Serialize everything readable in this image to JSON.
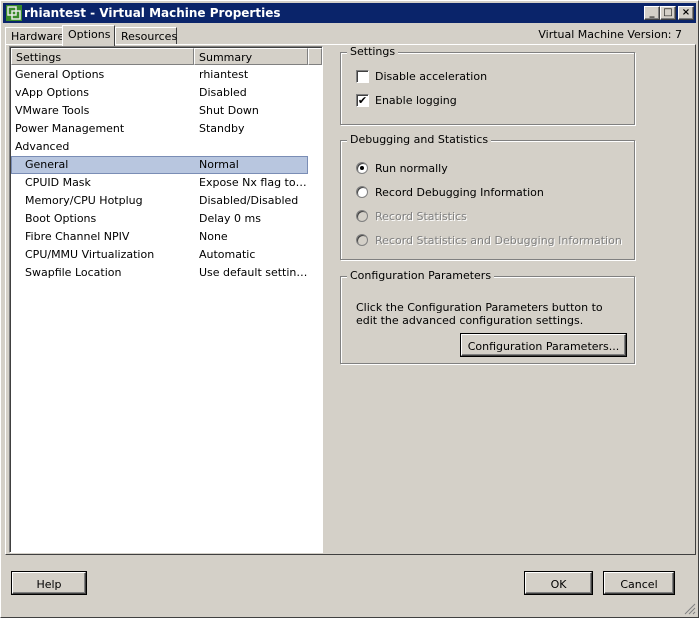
{
  "window": {
    "title": "rhiantest - Virtual Machine Properties",
    "min_glyph": "_",
    "max_glyph": "□",
    "close_glyph": "×"
  },
  "tabs": [
    {
      "label": "Hardware"
    },
    {
      "label": "Options"
    },
    {
      "label": "Resources"
    }
  ],
  "vm_version": "Virtual Machine Version: 7",
  "settings_list": {
    "headers": [
      "Settings",
      "Summary"
    ],
    "rows": [
      {
        "setting": "General Options",
        "summary": "rhiantest"
      },
      {
        "setting": "vApp Options",
        "summary": "Disabled"
      },
      {
        "setting": "VMware Tools",
        "summary": "Shut Down"
      },
      {
        "setting": "Power Management",
        "summary": "Standby"
      },
      {
        "setting": "Advanced",
        "summary": ""
      },
      {
        "setting": "General",
        "summary": "Normal"
      },
      {
        "setting": "CPUID Mask",
        "summary": "Expose Nx flag to ..."
      },
      {
        "setting": "Memory/CPU Hotplug",
        "summary": "Disabled/Disabled"
      },
      {
        "setting": "Boot Options",
        "summary": "Delay 0 ms"
      },
      {
        "setting": "Fibre Channel NPIV",
        "summary": "None"
      },
      {
        "setting": "CPU/MMU Virtualization",
        "summary": "Automatic"
      },
      {
        "setting": "Swapfile Location",
        "summary": "Use default settings"
      }
    ]
  },
  "settings_group": {
    "title": "Settings",
    "disable_acceleration": {
      "label": "Disable acceleration",
      "checked": false
    },
    "enable_logging": {
      "label": "Enable logging",
      "checked": true,
      "mark": "✔"
    }
  },
  "debug_group": {
    "title": "Debugging and Statistics",
    "options": [
      {
        "label": "Run normally",
        "checked": true,
        "enabled": true
      },
      {
        "label": "Record Debugging Information",
        "checked": false,
        "enabled": true
      },
      {
        "label": "Record Statistics",
        "checked": false,
        "enabled": false
      },
      {
        "label": "Record Statistics and Debugging Information",
        "checked": false,
        "enabled": false
      }
    ]
  },
  "config_group": {
    "title": "Configuration Parameters",
    "description": "Click the Configuration Parameters button to edit the advanced configuration settings.",
    "button": "Configuration Parameters..."
  },
  "footer": {
    "help": "Help",
    "ok": "OK",
    "cancel": "Cancel"
  },
  "colors": {
    "titlebar": "#0a246a",
    "selection": "#b8c6df",
    "face": "#d4d0c8"
  }
}
